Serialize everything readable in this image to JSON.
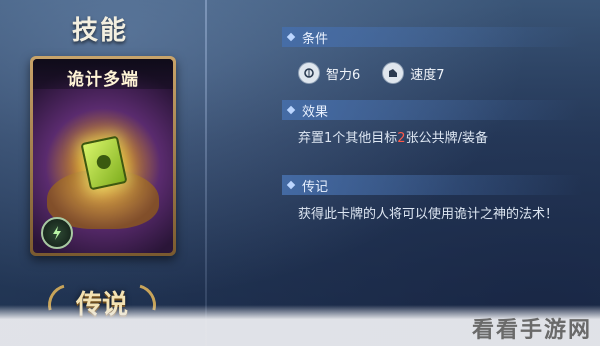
{
  "skill_title": "技能",
  "card": {
    "name": "诡计多端",
    "element_icon": "lightning-swirl-icon"
  },
  "rarity_badge": "传说",
  "sections": {
    "condition": {
      "label": "条件",
      "stats": [
        {
          "icon": "brain-icon",
          "text": "智力6"
        },
        {
          "icon": "boot-icon",
          "text": "速度7"
        }
      ]
    },
    "effect": {
      "label": "效果",
      "text_before": "弃置1个其他目标",
      "highlight": "2",
      "text_after": "张公共牌/装备"
    },
    "lore": {
      "label": "传记",
      "text": "获得此卡牌的人将可以使用诡计之神的法术！"
    }
  },
  "watermark": "看看手游网",
  "colors": {
    "highlight": "#ff5a4a",
    "header_bar": "#466eaa"
  }
}
